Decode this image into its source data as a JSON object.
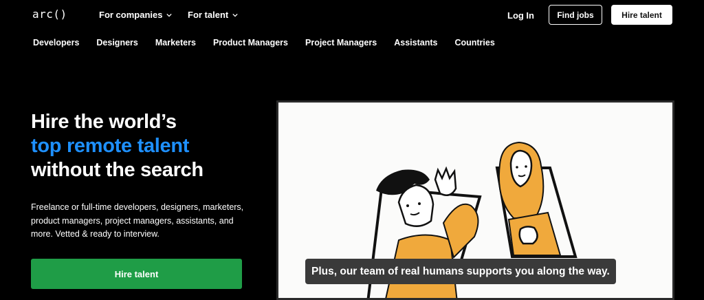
{
  "brand": {
    "logo_text": "arc()"
  },
  "topnav": {
    "for_companies": "For companies",
    "for_talent": "For talent",
    "log_in": "Log In",
    "find_jobs": "Find jobs",
    "hire_talent": "Hire talent"
  },
  "subnav": {
    "items": [
      "Developers",
      "Designers",
      "Marketers",
      "Product Managers",
      "Project Managers",
      "Assistants",
      "Countries"
    ]
  },
  "hero": {
    "title_line1": "Hire the world’s",
    "title_line2": "top remote talent",
    "title_line3": "without the search",
    "description": "Freelance or full-time developers, designers, marketers, product managers, project managers, assistants, and more. Vetted & ready to interview.",
    "cta": "Hire talent"
  },
  "video": {
    "caption": "Plus, our team of real humans supports you along the way."
  },
  "colors": {
    "accent_blue": "#1e90ff",
    "cta_green": "#1f9d47",
    "illustration_orange": "#f0a93c"
  }
}
